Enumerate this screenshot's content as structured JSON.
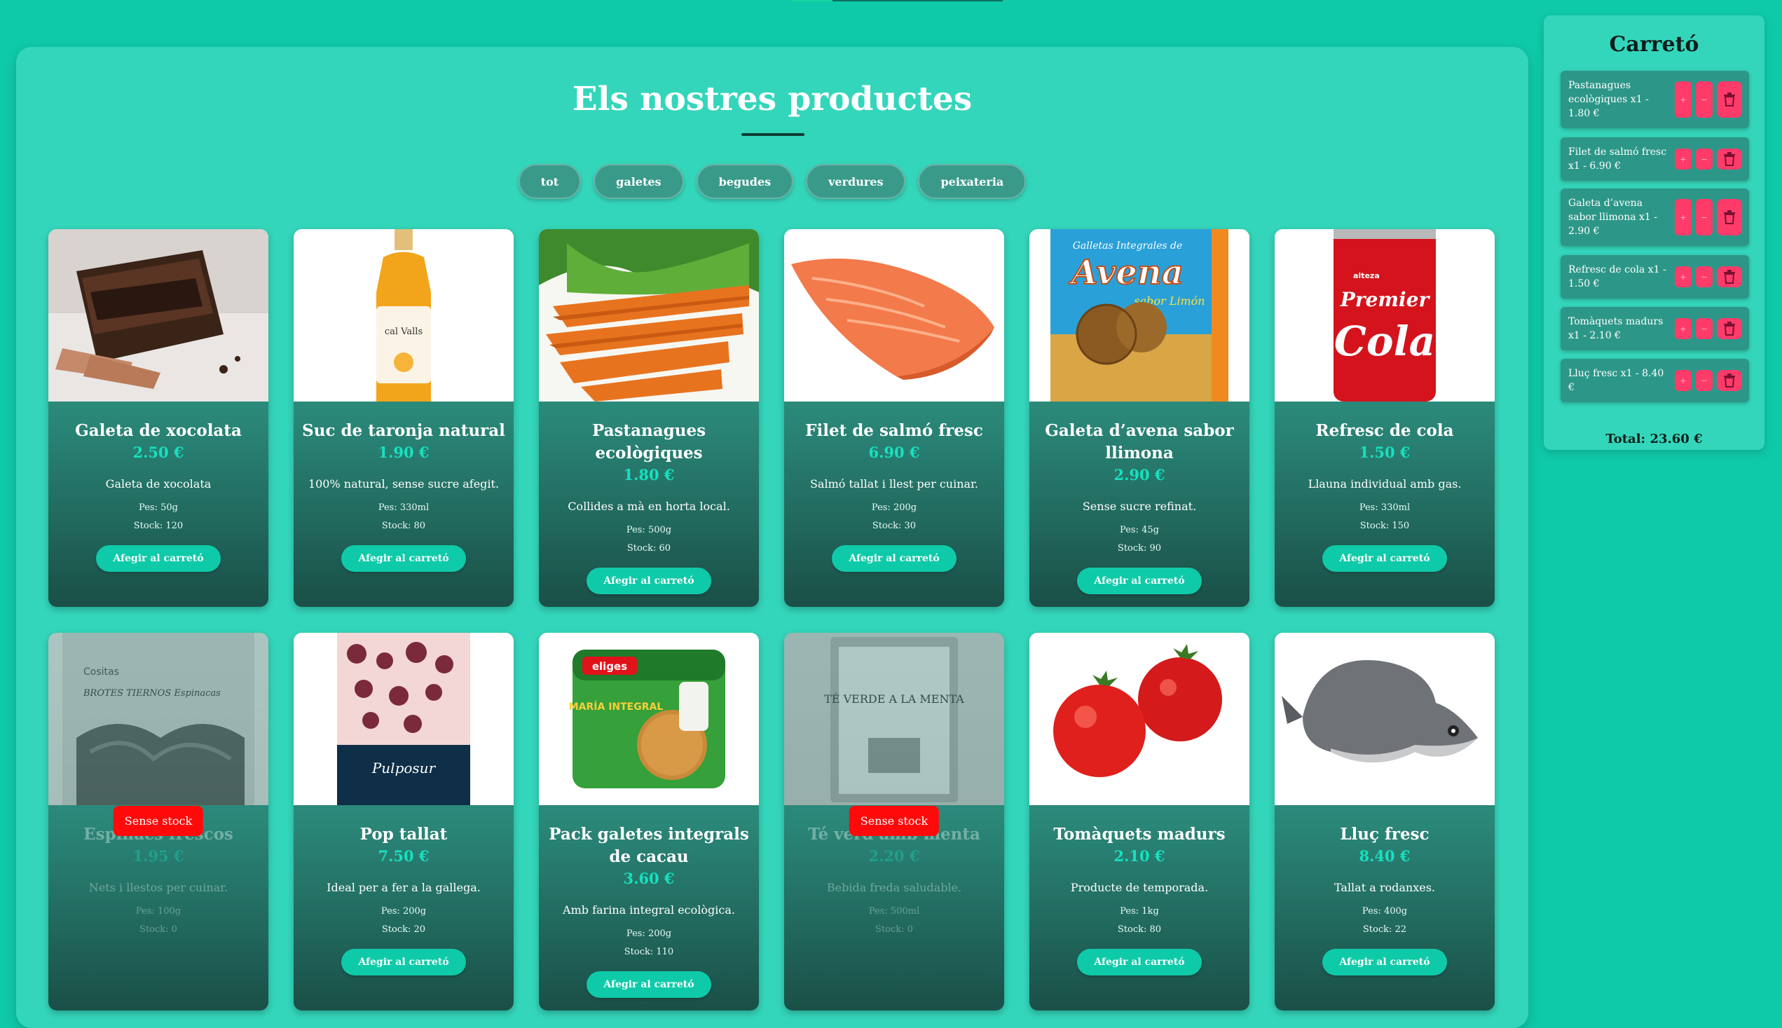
{
  "page": {
    "title": "Els nostres productes"
  },
  "filters": [
    {
      "label": "tot"
    },
    {
      "label": "galetes"
    },
    {
      "label": "begudes"
    },
    {
      "label": "verdures"
    },
    {
      "label": "peixateria"
    }
  ],
  "products": [
    {
      "name": "Galeta de xocolata",
      "price": "2.50 €",
      "desc": "Galeta de xocolata",
      "weight": "Pes: 50g",
      "stock": "Stock: 120",
      "add": "Afegir al carretó"
    },
    {
      "name": "Suc de taronja natural",
      "price": "1.90 €",
      "desc": "100% natural, sense sucre afegit.",
      "weight": "Pes: 330ml",
      "stock": "Stock: 80",
      "add": "Afegir al carretó"
    },
    {
      "name": "Pastanagues ecològiques",
      "price": "1.80 €",
      "desc": "Collides a mà en horta local.",
      "weight": "Pes: 500g",
      "stock": "Stock: 60",
      "add": "Afegir al carretó"
    },
    {
      "name": "Filet de salmó fresc",
      "price": "6.90 €",
      "desc": "Salmó tallat i llest per cuinar.",
      "weight": "Pes: 200g",
      "stock": "Stock: 30",
      "add": "Afegir al carretó"
    },
    {
      "name": "Galeta d’avena sabor llimona",
      "price": "2.90 €",
      "desc": "Sense sucre refinat.",
      "weight": "Pes: 45g",
      "stock": "Stock: 90",
      "add": "Afegir al carretó"
    },
    {
      "name": "Refresc de cola",
      "price": "1.50 €",
      "desc": "Llauna individual amb gas.",
      "weight": "Pes: 330ml",
      "stock": "Stock: 150",
      "add": "Afegir al carretó"
    },
    {
      "name": "Espinacs frescos",
      "price": "1.95 €",
      "desc": "Nets i llestos per cuinar.",
      "weight": "Pes: 100g",
      "stock": "Stock: 0",
      "badge": "Sense stock"
    },
    {
      "name": "Pop tallat",
      "price": "7.50 €",
      "desc": "Ideal per a fer a la gallega.",
      "weight": "Pes: 200g",
      "stock": "Stock: 20",
      "add": "Afegir al carretó"
    },
    {
      "name": "Pack galetes integrals de cacau",
      "price": "3.60 €",
      "desc": "Amb farina integral ecològica.",
      "weight": "Pes: 200g",
      "stock": "Stock: 110",
      "add": "Afegir al carretó"
    },
    {
      "name": "Té verd amb menta",
      "price": "2.20 €",
      "desc": "Bebida freda saludable.",
      "weight": "Pes: 500ml",
      "stock": "Stock: 0",
      "badge": "Sense stock"
    },
    {
      "name": "Tomàquets madurs",
      "price": "2.10 €",
      "desc": "Producte de temporada.",
      "weight": "Pes: 1kg",
      "stock": "Stock: 80",
      "add": "Afegir al carretó"
    },
    {
      "name": "Lluç fresc",
      "price": "8.40 €",
      "desc": "Tallat a rodanxes.",
      "weight": "Pes: 400g",
      "stock": "Stock: 22",
      "add": "Afegir al carretó"
    }
  ],
  "product_image_labels": {
    "juice_brand": "cal Valls",
    "oat_brand_top": "Galletas Integrales de",
    "oat_brand": "Avena",
    "oat_flavor": "sabor Limón",
    "cola_top": "alteza",
    "cola_brand": "Premier",
    "cola_word": "Cola",
    "spinach_brand": "Cositas",
    "spinach_name": "BROTES TIERNOS Espinacas",
    "octopus_brand": "Pulposur",
    "biscuit_brand": "eliges",
    "biscuit_name": "MARÍA INTEGRAL",
    "tea_title": "TÉ VERDE A LA MENTA"
  },
  "cart": {
    "title": "Carretó",
    "items": [
      {
        "text": "Pastanagues ecològiques x1 - 1.80 €",
        "plus": "+",
        "minus": "−"
      },
      {
        "text": "Filet de salmó fresc x1 - 6.90 €",
        "plus": "+",
        "minus": "−"
      },
      {
        "text": "Galeta d’avena sabor llimona x1 - 2.90 €",
        "plus": "+",
        "minus": "−"
      },
      {
        "text": "Refresc de cola x1 - 1.50 €",
        "plus": "+",
        "minus": "−"
      },
      {
        "text": "Tomàquets madurs x1 - 2.10 €",
        "plus": "+",
        "minus": "−"
      },
      {
        "text": "Lluç fresc x1 - 8.40 €",
        "plus": "+",
        "minus": "−"
      }
    ],
    "total": "Total: 23.60 €"
  },
  "colors": {
    "background": "#0fcaa9",
    "panel": "#34d6bb",
    "accent": "#17e0c0",
    "danger": "#ff0a0a",
    "cart_button": "#ff3b6a"
  }
}
